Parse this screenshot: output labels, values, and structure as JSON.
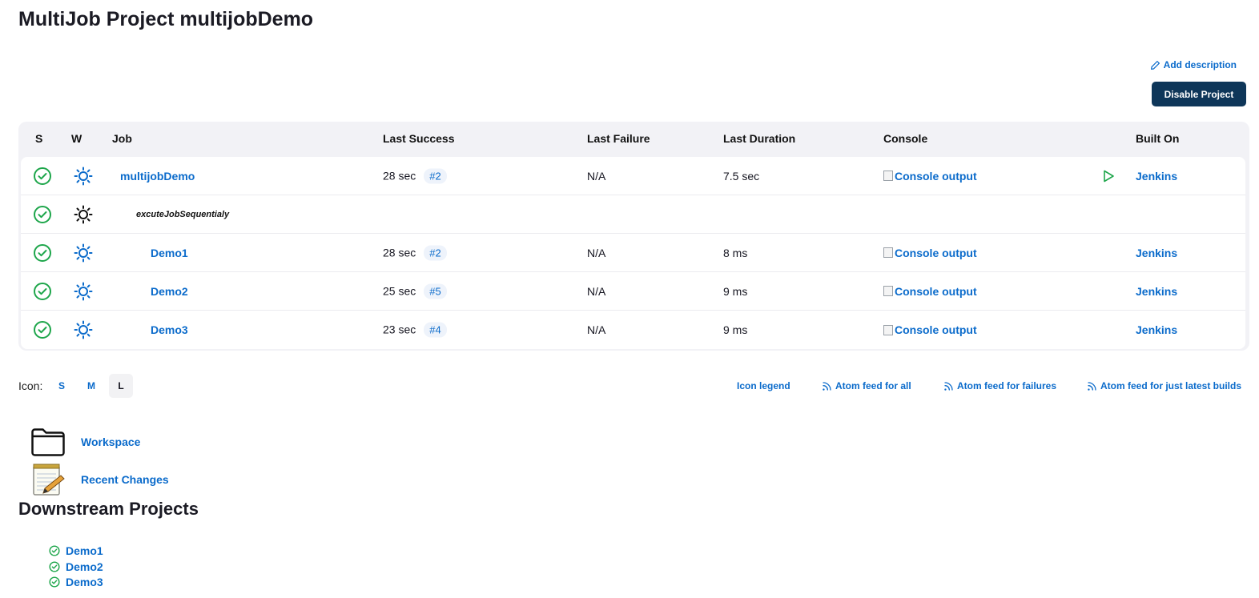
{
  "page": {
    "title": "MultiJob Project multijobDemo",
    "add_description": "Add description",
    "disable_button": "Disable Project"
  },
  "table": {
    "headers": {
      "s": "S",
      "w": "W",
      "job": "Job",
      "last_success": "Last Success",
      "last_failure": "Last Failure",
      "last_duration": "Last Duration",
      "console": "Console",
      "built_on": "Built On"
    },
    "rows": [
      {
        "job": "multijobDemo",
        "last_success": "28 sec",
        "build": "#2",
        "last_failure": "N/A",
        "last_duration": "7.5 sec",
        "console": "Console output",
        "built_on": "Jenkins"
      },
      {
        "phase": "excuteJobSequentialy"
      },
      {
        "job": "Demo1",
        "last_success": "28 sec",
        "build": "#2",
        "last_failure": "N/A",
        "last_duration": "8 ms",
        "console": "Console output",
        "built_on": "Jenkins"
      },
      {
        "job": "Demo2",
        "last_success": "25 sec",
        "build": "#5",
        "last_failure": "N/A",
        "last_duration": "9 ms",
        "console": "Console output",
        "built_on": "Jenkins"
      },
      {
        "job": "Demo3",
        "last_success": "23 sec",
        "build": "#4",
        "last_failure": "N/A",
        "last_duration": "9 ms",
        "console": "Console output",
        "built_on": "Jenkins"
      }
    ]
  },
  "icon_size": {
    "label": "Icon:",
    "options": [
      "S",
      "M",
      "L"
    ],
    "selected": "L"
  },
  "feeds": {
    "legend": "Icon legend",
    "all": "Atom feed for all",
    "failures": "Atom feed for failures",
    "latest": "Atom feed for just latest builds"
  },
  "tasks": {
    "workspace": "Workspace",
    "recent_changes": "Recent Changes"
  },
  "downstream": {
    "title": "Downstream Projects",
    "items": [
      "Demo1",
      "Demo2",
      "Demo3"
    ]
  },
  "colors": {
    "success": "#1ea64b",
    "link": "#0b6bcb",
    "button": "#0e3659"
  },
  "icons": [
    "check-circle-icon",
    "sun-icon",
    "play-icon",
    "rss-icon",
    "pencil-icon",
    "folder-icon",
    "notepad-icon"
  ]
}
